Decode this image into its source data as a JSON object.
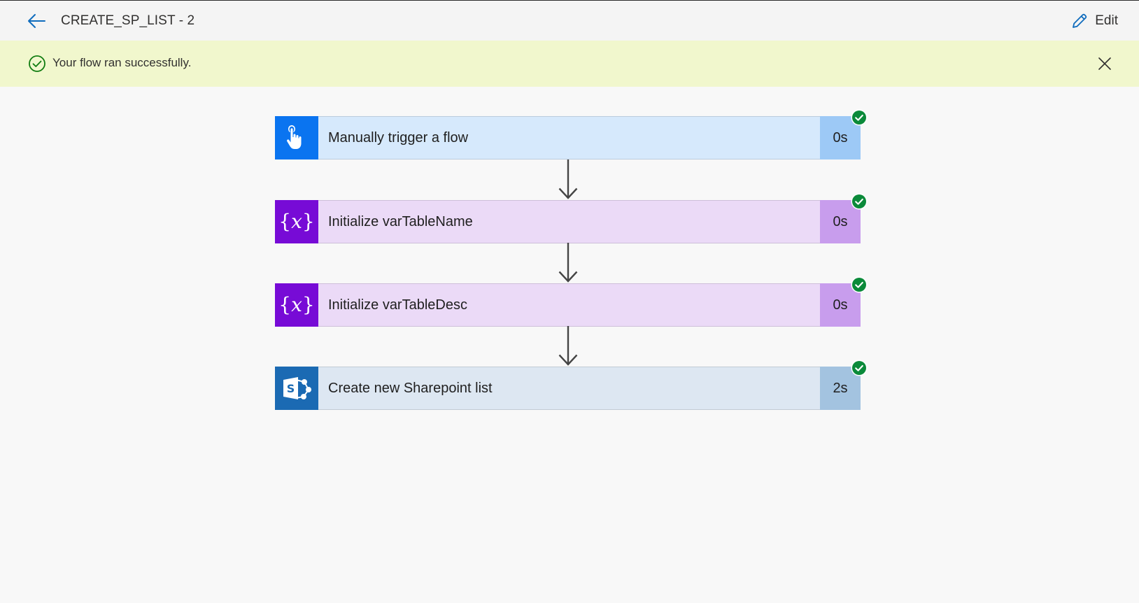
{
  "header": {
    "title": "CREATE_SP_LIST - 2",
    "edit_label": "Edit",
    "back_icon": "arrow-left-icon",
    "edit_icon": "pencil-icon"
  },
  "banner": {
    "message": "Your flow ran successfully.",
    "status_icon": "check-circle-icon",
    "close_icon": "close-icon",
    "background_color": "#f1f7cd"
  },
  "steps": [
    {
      "label": "Manually trigger a flow",
      "duration": "0s",
      "icon": "touch-hand-icon",
      "status": "succeeded",
      "icon_color": "#0a74f0",
      "label_color": "#d6e9fc",
      "duration_color": "#9dc9f6"
    },
    {
      "label": "Initialize varTableName",
      "duration": "0s",
      "icon": "variable-icon",
      "status": "succeeded",
      "icon_color": "#770bd6",
      "label_color": "#ebdaf7",
      "duration_color": "#c89ded"
    },
    {
      "label": "Initialize varTableDesc",
      "duration": "0s",
      "icon": "variable-icon",
      "status": "succeeded",
      "icon_color": "#770bd6",
      "label_color": "#ebdaf7",
      "duration_color": "#c89ded"
    },
    {
      "label": "Create new Sharepoint list",
      "duration": "2s",
      "icon": "sharepoint-icon",
      "status": "succeeded",
      "icon_color": "#1b6ab3",
      "label_color": "#dde7f2",
      "duration_color": "#a3c3e0"
    }
  ],
  "colors": {
    "accent_blue": "#0f6cbd",
    "success_green": "#0b8a3a",
    "arrow": "#444444"
  }
}
